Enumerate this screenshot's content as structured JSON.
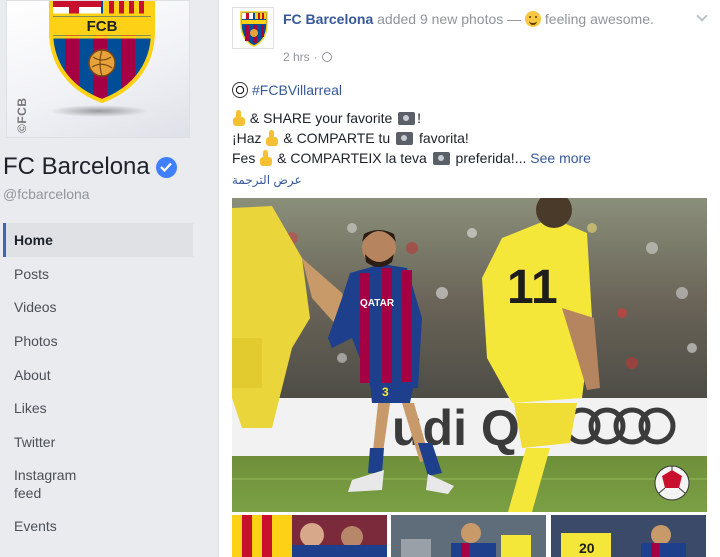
{
  "profile": {
    "name": "FC Barcelona",
    "handle": "@fcbarcelona",
    "crest_text": "FCB",
    "watermark": "©FCB"
  },
  "nav": {
    "items": [
      {
        "label": "Home",
        "active": true
      },
      {
        "label": "Posts"
      },
      {
        "label": "Videos"
      },
      {
        "label": "Photos"
      },
      {
        "label": "About"
      },
      {
        "label": "Likes"
      },
      {
        "label": "Twitter"
      },
      {
        "label": "Instagram feed"
      },
      {
        "label": "Events"
      }
    ]
  },
  "post": {
    "author": "FC Barcelona",
    "action": "added 9 new photos —",
    "feeling": "feeling awesome.",
    "time": "2 hrs",
    "hashtag": "#FCBVillarreal",
    "line1_text": "& SHARE your favorite",
    "line1_end": "!",
    "line2_start": "¡Haz",
    "line2_mid": "& COMPARTE tu",
    "line2_end": "favorita!",
    "line3_start": "Fes",
    "line3_mid": "& COMPARTEIX la teva",
    "line3_end": "preferida!...",
    "see_more": "See more",
    "translate": "عرض الترجمة",
    "photo_ad_text": "udi Q5",
    "player_number_front": "3",
    "player_number_back": "11",
    "shirt_sponsor": "QATAR"
  },
  "colors": {
    "link": "#365899",
    "accent": "#4267b2",
    "verified": "#4080ff",
    "barca_blue": "#1d3f8c",
    "barca_red": "#a50044",
    "villarreal_yellow": "#f5e63a"
  }
}
